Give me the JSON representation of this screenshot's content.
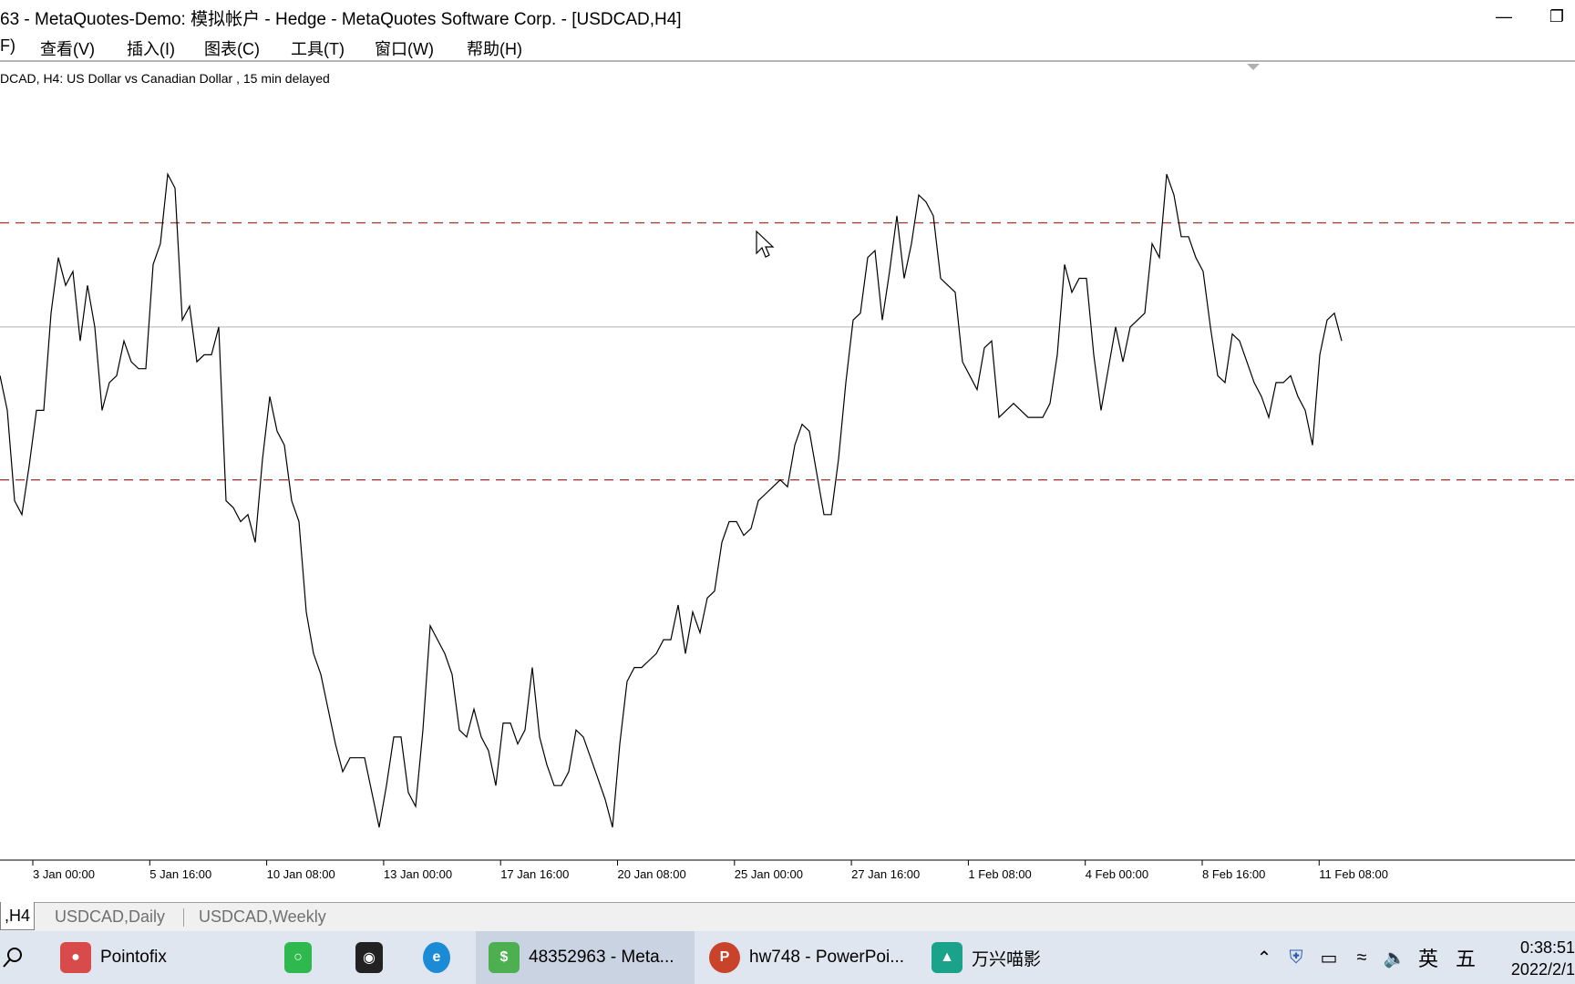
{
  "window": {
    "title": "63 - MetaQuotes-Demo: 模拟帐户 - Hedge - MetaQuotes Software Corp. - [USDCAD,H4]"
  },
  "menu": {
    "items": [
      "F)",
      "查看(V)",
      "插入(I)",
      "图表(C)",
      "工具(T)",
      "窗口(W)",
      "帮助(H)"
    ]
  },
  "chart": {
    "caption": "DCAD, H4:  US Dollar vs Canadian Dollar , 15 min delayed",
    "line_color": "#000000",
    "level_color": "#a04040",
    "mid_color": "#b0b0b0"
  },
  "chart_data": {
    "type": "line",
    "title": "DCAD, H4:  US Dollar vs Canadian Dollar , 15 min delayed",
    "xlabel": "",
    "ylabel": "",
    "x_ticks": [
      "3 Jan 00:00",
      "5 Jan 16:00",
      "10 Jan 08:00",
      "13 Jan 00:00",
      "17 Jan 16:00",
      "20 Jan 08:00",
      "25 Jan 00:00",
      "27 Jan 16:00",
      "1 Feb 08:00",
      "4 Feb 00:00",
      "8 Feb 16:00",
      "11 Feb 08:00"
    ],
    "ylim": [
      0,
      100
    ],
    "grid": false,
    "horizontal_levels": [
      87,
      50,
      72
    ],
    "series": [
      {
        "values": [
          65,
          60,
          47,
          45,
          52,
          60,
          60,
          74,
          82,
          78,
          80,
          70,
          78,
          72,
          60,
          64,
          65,
          70,
          67,
          66,
          66,
          81,
          84,
          94,
          92,
          73,
          75,
          67,
          68,
          68,
          72,
          47,
          46,
          44,
          45,
          41,
          53,
          62,
          57,
          55,
          47,
          44,
          31,
          25,
          22,
          17,
          12,
          8,
          10,
          10,
          10,
          5,
          0,
          6,
          13,
          13,
          5,
          3,
          14,
          29,
          27,
          25,
          22,
          14,
          13,
          17,
          13,
          11,
          6,
          15,
          15,
          12,
          14,
          23,
          13,
          9,
          6,
          6,
          8,
          14,
          13,
          10,
          7,
          4,
          0,
          12,
          21,
          23,
          23,
          24,
          25,
          27,
          27,
          32,
          25,
          31,
          28,
          33,
          34,
          41,
          44,
          44,
          42,
          43,
          47,
          48,
          49,
          50,
          49,
          55,
          58,
          57,
          51,
          45,
          45,
          53,
          64,
          73,
          74,
          82,
          83,
          73,
          80,
          88,
          79,
          84,
          91,
          90,
          88,
          79,
          78,
          77,
          67,
          65,
          63,
          69,
          70,
          59,
          60,
          61,
          60,
          59,
          59,
          59,
          61,
          68,
          81,
          77,
          79,
          79,
          68,
          60,
          66,
          72,
          67,
          72,
          73,
          74,
          84,
          82,
          94,
          91,
          85,
          85,
          82,
          80,
          72,
          65,
          64,
          71,
          70,
          67,
          64,
          62,
          59,
          64,
          64,
          65,
          62,
          60,
          55,
          68,
          73,
          74,
          70
        ],
        "note_free": true
      }
    ]
  },
  "tabs": {
    "items": [
      ",H4",
      "USDCAD,Daily",
      "USDCAD,Weekly"
    ]
  },
  "taskbar": {
    "apps": [
      {
        "label": "Pointofix",
        "icon": "pointofix-icon",
        "color": "#d94a4a"
      },
      {
        "label": "",
        "icon": "wechat-icon",
        "color": "#2fb84d"
      },
      {
        "label": "",
        "icon": "qq-icon",
        "color": "#222222"
      },
      {
        "label": "",
        "icon": "edge-icon",
        "color": "#1b8bd6"
      },
      {
        "label": "48352963 - Meta...",
        "icon": "metatrader-icon",
        "color": "#4caf50"
      },
      {
        "label": "hw748 - PowerPoi...",
        "icon": "powerpoint-icon",
        "color": "#c9432b"
      },
      {
        "label": "万兴喵影",
        "icon": "wondershare-icon",
        "color": "#1aa38a"
      }
    ],
    "tray_ime_1": "英",
    "tray_ime_2": "五",
    "clock_time": "0:38:51",
    "clock_date": "2022/2/1"
  }
}
